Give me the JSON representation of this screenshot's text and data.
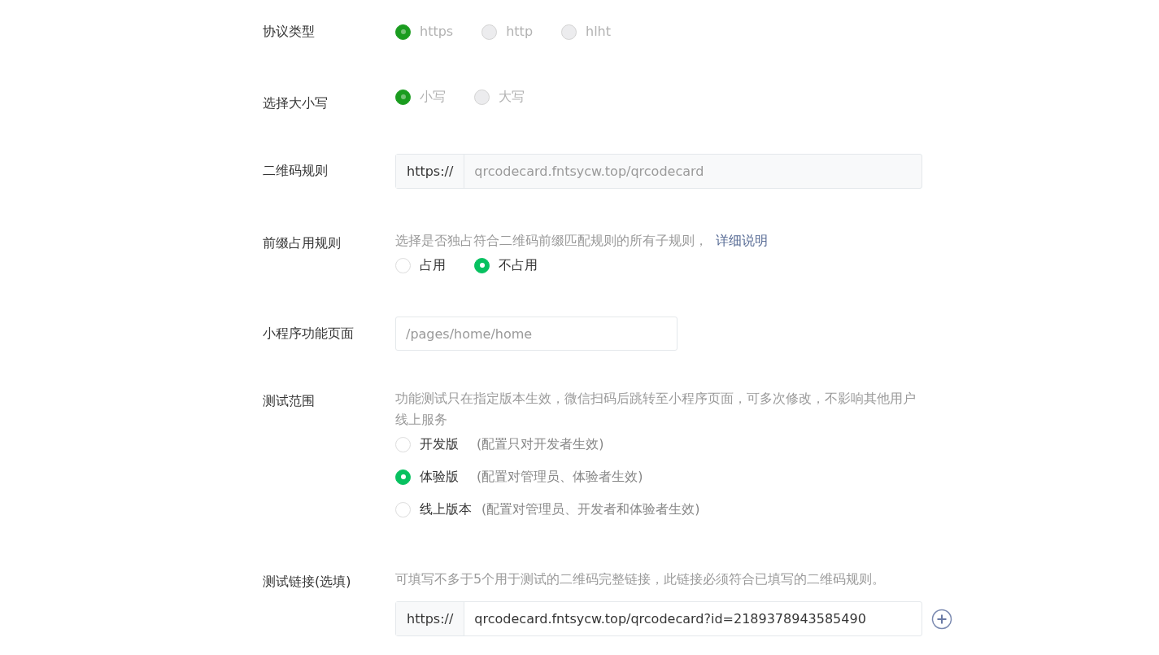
{
  "rows": [
    {
      "label": "协议类型",
      "kind": "radio",
      "disabled": true,
      "options": [
        {
          "label": "https",
          "selected": true
        },
        {
          "label": "http",
          "selected": false
        },
        {
          "label": "hlht",
          "selected": false
        }
      ]
    },
    {
      "label": "选择大小写",
      "kind": "radio",
      "disabled": true,
      "options": [
        {
          "label": "小写",
          "selected": true
        },
        {
          "label": "大写",
          "selected": false
        }
      ]
    },
    {
      "label": "二维码规则",
      "kind": "prefixed_input",
      "disabled": true,
      "prefix": "https://",
      "value": "qrcodecard.fntsycw.top/qrcodecard"
    },
    {
      "label": "前缀占用规则",
      "kind": "radio",
      "disabled": false,
      "hint": "选择是否独占符合二维码前缀匹配规则的所有子规则，",
      "link": "详细说明",
      "options": [
        {
          "label": "占用",
          "selected": false
        },
        {
          "label": "不占用",
          "selected": true
        }
      ]
    },
    {
      "label": "小程序功能页面",
      "kind": "input",
      "placeholder": "/pages/home/home"
    },
    {
      "label": "测试范围",
      "kind": "radio",
      "disabled": false,
      "stacked": true,
      "hint": "功能测试只在指定版本生效，微信扫码后跳转至小程序页面，可多次修改，不影响其他用户线上服务",
      "options": [
        {
          "label": "开发版",
          "note": "(配置只对开发者生效)",
          "selected": false
        },
        {
          "label": "体验版",
          "note": "(配置对管理员、体验者生效)",
          "selected": true
        },
        {
          "label": "线上版本",
          "note": "(配置对管理员、开发者和体验者生效)",
          "selected": false
        }
      ]
    },
    {
      "label": "测试链接(选填)",
      "kind": "prefixed_input",
      "disabled": false,
      "add_button": true,
      "hint": "可填写不多于5个用于测试的二维码完整链接，此链接必须符合已填写的二维码规则。",
      "prefix": "https://",
      "value": "qrcodecard.fntsycw.top/qrcodecard?id=2189378943585490"
    }
  ]
}
